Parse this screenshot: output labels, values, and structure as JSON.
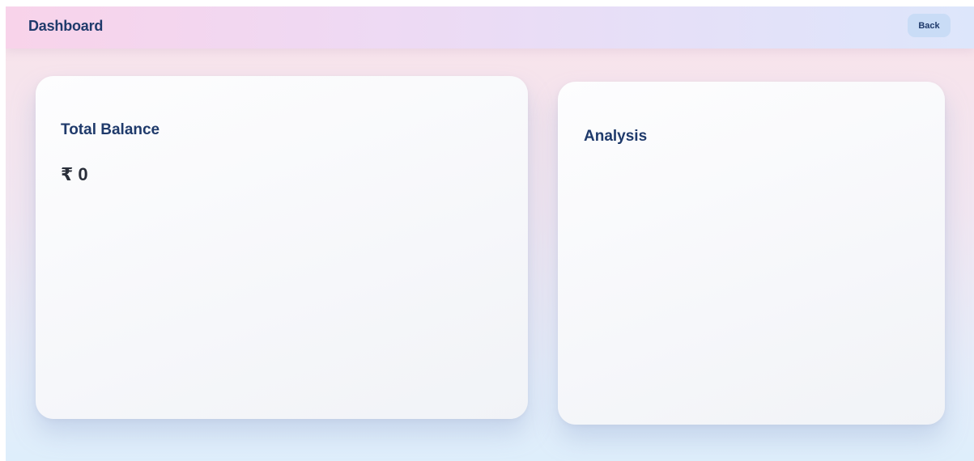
{
  "header": {
    "title": "Dashboard",
    "back_label": "Back"
  },
  "balance_card": {
    "title": "Total Balance",
    "currency_symbol": "₹",
    "amount": "0",
    "display": "₹ 0"
  },
  "analysis_card": {
    "title": "Analysis"
  },
  "colors": {
    "accent_text": "#1f3a6b",
    "back_button_bg": "#c9dcf6",
    "card_bg": "#fdfdfe"
  }
}
